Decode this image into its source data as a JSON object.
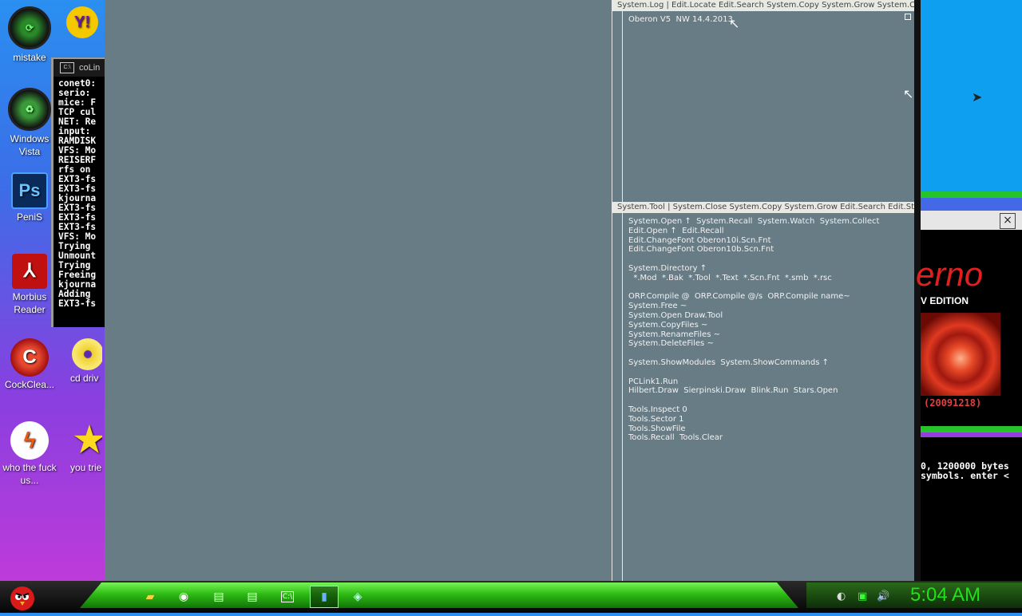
{
  "desktop": {
    "icons": [
      {
        "label": "mistake",
        "icon": "green-orb-icon"
      },
      {
        "label": "Windows Vista",
        "icon": "recycle-orb-icon"
      },
      {
        "label": "PeniS",
        "icon": "photoshop-icon"
      },
      {
        "label": "Morbius Reader",
        "icon": "pdf-reader-icon"
      },
      {
        "label": "CockClea...",
        "icon": "ccleaner-icon"
      },
      {
        "label": "who the fuck us...",
        "icon": "lightning-icon"
      },
      {
        "label": "cd driv",
        "icon": "cd-drive-icon"
      },
      {
        "label": "you trie",
        "icon": "star-icon"
      }
    ]
  },
  "console": {
    "title": "coLin",
    "lines": [
      "conet0:",
      "serio:",
      "mice: F",
      "TCP cul",
      "NET: Re",
      "input:",
      "RAMDISK",
      "VFS: Mo",
      "REISERF",
      "rfs on",
      "EXT3-fs",
      "EXT3-fs",
      "kjourna",
      "EXT3-fs",
      "EXT3-fs",
      "EXT3-fs",
      "VFS: Mo",
      "Trying",
      "Unmount",
      "Trying",
      "Freeing",
      "kjourna",
      "Adding",
      "EXT3-fs"
    ]
  },
  "oberon": {
    "log_menu": "System.Log | Edit.Locate Edit.Search System.Copy System.Grow System.Clear",
    "log_text": "Oberon V5  NW 14.4.2013",
    "tool_menu": "System.Tool | System.Close System.Copy System.Grow Edit.Search Edit.Store",
    "tool_lines": [
      "System.Open ↑  System.Recall  System.Watch  System.Collect",
      "Edit.Open ↑  Edit.Recall",
      "Edit.ChangeFont Oberon10i.Scn.Fnt",
      "Edit.ChangeFont Oberon10b.Scn.Fnt",
      "",
      "System.Directory ↑",
      "  *.Mod  *.Bak  *.Tool  *.Text  *.Scn.Fnt  *.smb  *.rsc",
      "",
      "ORP.Compile @  ORP.Compile @/s  ORP.Compile name~",
      "System.Free ~",
      "System.Open Draw.Tool",
      "System.CopyFiles ~",
      "System.RenameFiles ~",
      "System.DeleteFiles ~",
      "",
      "System.ShowModules  System.ShowCommands ↑",
      "",
      "PCLink1.Run",
      "Hilbert.Draw  Sierpinski.Draw  Blink.Run  Stars.Open",
      "",
      "Tools.Inspect 0",
      "Tools.Sector 1",
      "Tools.ShowFile",
      "Tools.Recall  Tools.Clear"
    ]
  },
  "popup": {
    "brand": "erno",
    "edition": "V EDITION",
    "version": "(20091218)",
    "close_label": "×"
  },
  "qemu_console": {
    "lines": [
      "0, 1200000 bytes",
      "symbols. enter <"
    ]
  },
  "taskbar": {
    "clock": "5:04 AM"
  }
}
